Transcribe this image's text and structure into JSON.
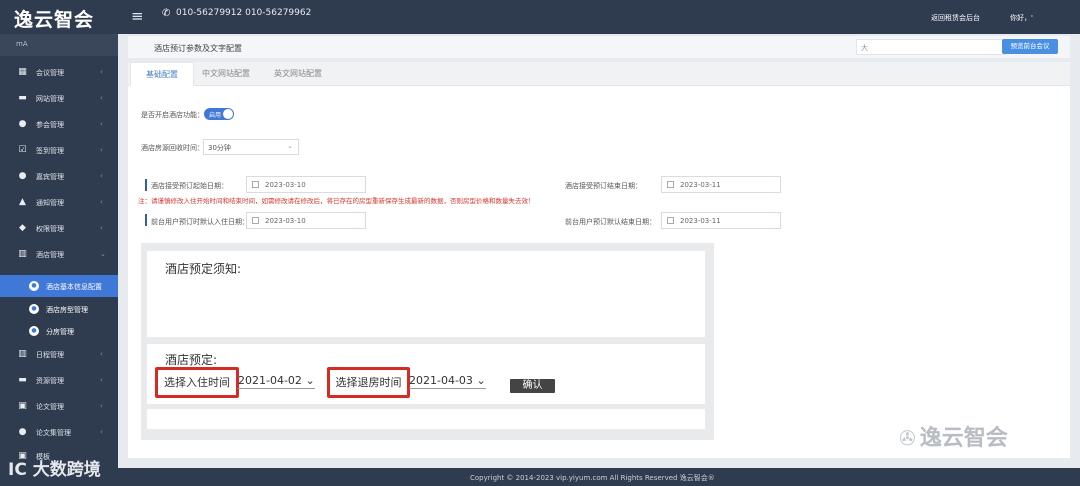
{
  "topbar": {
    "logo": "逸云智会",
    "menu_icon": "≡",
    "phone_icon": "✆",
    "phone": "010-56279912  010-56279962",
    "back_link": "返回租赁会后台",
    "greeting": "你好，'"
  },
  "sidebar": {
    "top_label": "mA",
    "items": [
      {
        "label": "会议管理",
        "icon": "▦"
      },
      {
        "label": "网站管理",
        "icon": "▬"
      },
      {
        "label": "参会管理",
        "icon": "●"
      },
      {
        "label": "签到管理",
        "icon": "☑"
      },
      {
        "label": "嘉宾管理",
        "icon": "●"
      },
      {
        "label": "通知管理",
        "icon": "▲"
      },
      {
        "label": "权限管理",
        "icon": "◆"
      },
      {
        "label": "酒店管理",
        "icon": "▥"
      }
    ],
    "sub_items": [
      {
        "label": "酒店基本信息配置",
        "icon": "●"
      },
      {
        "label": "酒店房型管理",
        "icon": "●"
      },
      {
        "label": "分房管理",
        "icon": "●"
      }
    ],
    "items_after": [
      {
        "label": "日程管理",
        "icon": "▥"
      },
      {
        "label": "资源管理",
        "icon": "▬"
      },
      {
        "label": "论文管理",
        "icon": "▣"
      },
      {
        "label": "论文集管理",
        "icon": "●"
      },
      {
        "label": "模板",
        "icon": "▣"
      }
    ]
  },
  "header": {
    "title": "酒店预订参数及文字配置",
    "input_value": "大",
    "button": "预览前台会议"
  },
  "tabs": [
    {
      "label": "基础配置"
    },
    {
      "label": "中文网站配置"
    },
    {
      "label": "英文网站配置"
    }
  ],
  "form": {
    "enable_label": "是否开启酒店功能：",
    "enable_toggle": "启用",
    "recycle_label": "酒店房源回收时间：",
    "recycle_value": "30分钟",
    "start_label": "酒店接受预订起始日期：",
    "start_value": "2023-03-10",
    "end_label": "酒店接受预订结束日期：",
    "end_value": "2023-03-11",
    "warning": "注：请谨慎修改入住开始时间和结束时间，如需修改请在修改后，将已存在的房型重新保存生成最新的数据，否则房型价格和数量失去效！",
    "default_in_label": "前台用户预订时默认入住日期：",
    "default_in_value": "2023-03-10",
    "default_out_label": "前台用户预订默认结束日期：",
    "default_out_value": "2023-03-11"
  },
  "preview": {
    "notice_title": "酒店预定须知:",
    "booking_title": "酒店预定:",
    "checkin_label": "选择入住时间",
    "checkin_value": "2021-04-02",
    "checkout_label": "选择退房时间",
    "checkout_value": "2021-04-03",
    "confirm": "确认",
    "chevron": "⌄"
  },
  "watermark": {
    "logo": "逸云智会",
    "bottom": "IC 大数跨境"
  },
  "footer": {
    "text": "Copyright © 2014-2023 vip.yiyum.com All Rights Reserved  逸云智会®"
  },
  "colors": {
    "sidebar_bg": "#2f3b4e",
    "accent": "#3f78d6",
    "warning": "#d9342b",
    "highlight_border": "#d62b25"
  }
}
